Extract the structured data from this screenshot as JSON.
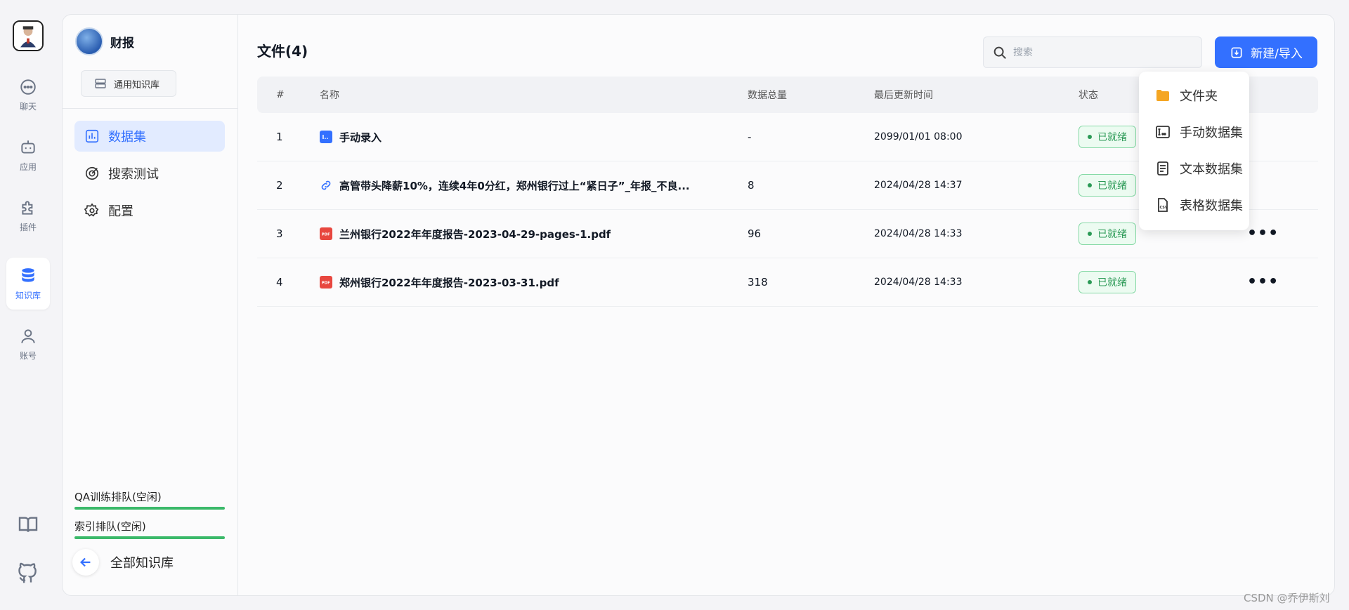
{
  "rail": {
    "items": [
      {
        "label": "聊天",
        "icon": "chat-icon"
      },
      {
        "label": "应用",
        "icon": "robot-icon"
      },
      {
        "label": "插件",
        "icon": "puzzle-icon"
      },
      {
        "label": "知识库",
        "icon": "database-icon"
      },
      {
        "label": "账号",
        "icon": "user-icon"
      }
    ],
    "bottom": [
      {
        "icon": "book-icon"
      },
      {
        "icon": "github-icon"
      }
    ],
    "accent": "#3370ff"
  },
  "kb": {
    "name": "财报",
    "type_label": "通用知识库"
  },
  "nav": [
    {
      "label": "数据集",
      "active": true
    },
    {
      "label": "搜索测试",
      "active": false
    },
    {
      "label": "配置",
      "active": false
    }
  ],
  "queues": [
    {
      "label": "QA训练排队(空闲)"
    },
    {
      "label": "索引排队(空闲)"
    }
  ],
  "back_label": "全部知识库",
  "main": {
    "title": "文件(4)",
    "search_placeholder": "搜索",
    "new_button": "新建/导入",
    "columns": [
      "#",
      "名称",
      "数据总量",
      "最后更新时间",
      "状态"
    ],
    "rows": [
      {
        "idx": "1",
        "name": "手动录入",
        "type": "manual",
        "total": "-",
        "time": "2099/01/01 08:00",
        "status": "已就绪"
      },
      {
        "idx": "2",
        "name": "高管带头降薪10%，连续4年0分红，郑州银行过上“紧日子”_年报_不良...",
        "type": "link",
        "total": "8",
        "time": "2024/04/28 14:37",
        "status": "已就绪"
      },
      {
        "idx": "3",
        "name": "兰州银行2022年年度报告-2023-04-29-pages-1.pdf",
        "type": "pdf",
        "total": "96",
        "time": "2024/04/28 14:33",
        "status": "已就绪"
      },
      {
        "idx": "4",
        "name": "郑州银行2022年年度报告-2023-03-31.pdf",
        "type": "pdf",
        "total": "318",
        "time": "2024/04/28 14:33",
        "status": "已就绪"
      }
    ]
  },
  "menu": [
    {
      "label": "文件夹",
      "icon": "folder-icon"
    },
    {
      "label": "手动数据集",
      "icon": "manual-dataset-icon"
    },
    {
      "label": "文本数据集",
      "icon": "text-dataset-icon"
    },
    {
      "label": "表格数据集",
      "icon": "csv-dataset-icon"
    }
  ],
  "watermark": "CSDN @乔伊斯刘"
}
